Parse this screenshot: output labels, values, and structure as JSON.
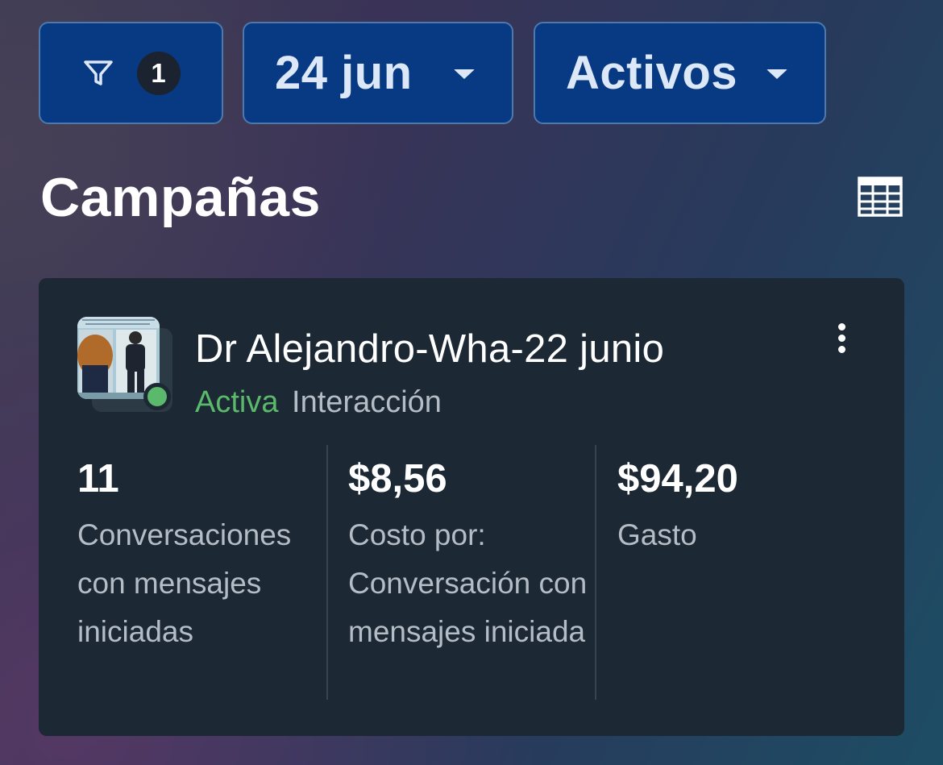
{
  "filters": {
    "filter_badge": "1",
    "date_label": "24 jun",
    "status_label": "Activos"
  },
  "section": {
    "title": "Campañas"
  },
  "campaign": {
    "name": "Dr Alejandro-Wha-22 junio",
    "status": "Activa",
    "objective": "Interacción",
    "status_color": "#5ab96a",
    "metrics": [
      {
        "value": "11",
        "label": "Conversaciones con mensajes iniciadas"
      },
      {
        "value": "$8,56",
        "label": "Costo por: Conversación con mensajes iniciada"
      },
      {
        "value": "$94,20",
        "label": "Gasto"
      }
    ]
  },
  "icons": {
    "filter": "filter-icon",
    "dropdown": "caret-down-icon",
    "table": "table-view-icon",
    "more": "more-vertical-icon"
  },
  "colors": {
    "chip_background": "#073a82",
    "card_background": "#1c2833",
    "active_green": "#5ab96a"
  }
}
